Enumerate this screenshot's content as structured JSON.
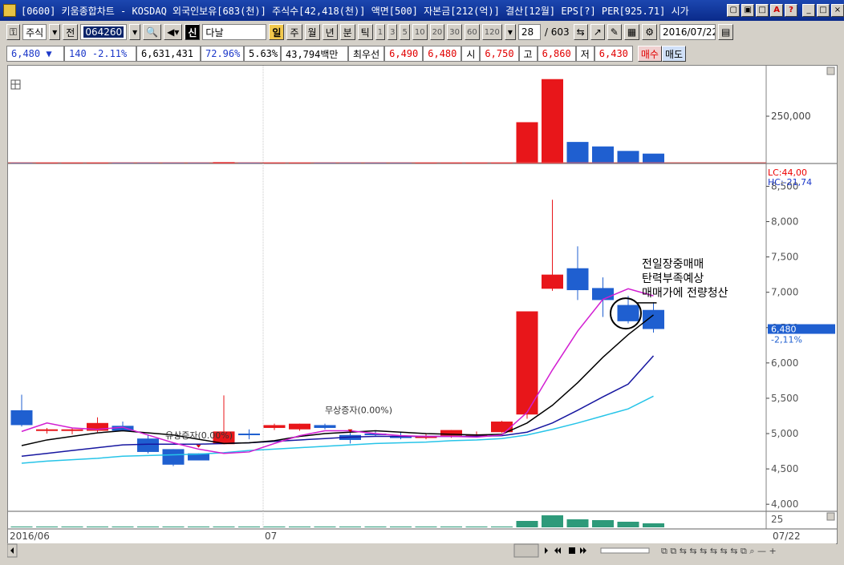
{
  "window": {
    "title": "[0600] 키움종합차트 - KOSDAQ 외국인보유[683(천)] 주식수[42,418(천)] 액면[500] 자본금[212(억)] 결산[12월] EPS[?] PER[925.71] 시가",
    "buttons": [
      "▢",
      "▣",
      "□",
      "A",
      "?",
      "_",
      "□",
      "×"
    ]
  },
  "toolbar": {
    "market": "주식",
    "prev_label": "전",
    "code": "064260",
    "flag": "신",
    "name": "다날",
    "periods": [
      "일",
      "주",
      "월",
      "년",
      "분",
      "틱"
    ],
    "intervals": [
      "1",
      "3",
      "5",
      "10",
      "20",
      "30",
      "60",
      "120"
    ],
    "count": "28",
    "total": "/ 603",
    "date": "2016/07/22"
  },
  "quote": {
    "price": "6,480 ▼",
    "change": "140 -2.11%",
    "volume": "6,631,431",
    "ratio1": "72.96%",
    "ratio2": "5.63%",
    "amount": "43,794백만",
    "best_label": "최우선",
    "ask": "6,490",
    "bid": "6,480",
    "open_label": "시",
    "open": "6,750",
    "high_label": "고",
    "high": "6,860",
    "low_label": "저",
    "low": "6,430",
    "buy_label": "매수",
    "sell_label": "매도"
  },
  "annotations": {
    "rights_issue": "유상증자(0.00%)",
    "bonus_issue": "무상증자(0.00%)",
    "note": [
      "전일장중매매",
      "탄력부족예상",
      "매매가에 전량청산"
    ],
    "lc": "LC:44,00",
    "hc": "HC:-21,74",
    "last_price": "6,480",
    "last_change": "-2,11%",
    "vol_axis": "250,000",
    "sub_axis": "25",
    "date_left": "2016/06",
    "date_mid": "07",
    "date_right": "07/22"
  },
  "colors": {
    "up": "#e8161a",
    "down": "#1f5fd0",
    "ma5": "#d21ed2",
    "ma10": "#000000",
    "ma20": "#1717a0",
    "ma60": "#26c4e8"
  },
  "chart_data": {
    "type": "candlestick",
    "price_ticks": [
      "8,500",
      "8,000",
      "7,500",
      "7,000",
      "6,500",
      "6,000",
      "5,500",
      "5,000",
      "4,500",
      "4,000"
    ],
    "ylim": [
      3900,
      8800
    ],
    "candles": [
      {
        "o": 5330,
        "h": 5550,
        "l": 5100,
        "c": 5120
      },
      {
        "o": 5040,
        "h": 5080,
        "l": 5000,
        "c": 5060
      },
      {
        "o": 5040,
        "h": 5080,
        "l": 4990,
        "c": 5060
      },
      {
        "o": 5040,
        "h": 5230,
        "l": 5020,
        "c": 5150
      },
      {
        "o": 5110,
        "h": 5170,
        "l": 5040,
        "c": 5040
      },
      {
        "o": 4930,
        "h": 4990,
        "l": 4720,
        "c": 4740
      },
      {
        "o": 4780,
        "h": 4780,
        "l": 4540,
        "c": 4560
      },
      {
        "o": 4720,
        "h": 4720,
        "l": 4620,
        "c": 4620
      },
      {
        "o": 4850,
        "h": 5540,
        "l": 4850,
        "c": 5030
      },
      {
        "o": 5000,
        "h": 5060,
        "l": 4920,
        "c": 4980
      },
      {
        "o": 5080,
        "h": 5140,
        "l": 5050,
        "c": 5120
      },
      {
        "o": 5060,
        "h": 5140,
        "l": 5040,
        "c": 5140
      },
      {
        "o": 5120,
        "h": 5140,
        "l": 5060,
        "c": 5080
      },
      {
        "o": 4980,
        "h": 5010,
        "l": 4860,
        "c": 4910
      },
      {
        "o": 5000,
        "h": 5030,
        "l": 4960,
        "c": 4980
      },
      {
        "o": 4960,
        "h": 5020,
        "l": 4920,
        "c": 4940
      },
      {
        "o": 4950,
        "h": 5000,
        "l": 4920,
        "c": 4960
      },
      {
        "o": 4970,
        "h": 5050,
        "l": 4940,
        "c": 5050
      },
      {
        "o": 4980,
        "h": 5030,
        "l": 4960,
        "c": 4990
      },
      {
        "o": 5020,
        "h": 5180,
        "l": 5010,
        "c": 5170
      },
      {
        "o": 5270,
        "h": 6730,
        "l": 5210,
        "c": 6730
      },
      {
        "o": 7050,
        "h": 8310,
        "l": 7020,
        "c": 7250
      },
      {
        "o": 7340,
        "h": 7650,
        "l": 6890,
        "c": 7030
      },
      {
        "o": 7060,
        "h": 7210,
        "l": 6650,
        "c": 6890
      },
      {
        "o": 6820,
        "h": 6950,
        "l": 6560,
        "c": 6590
      },
      {
        "o": 6750,
        "h": 6860,
        "l": 6430,
        "c": 6480
      }
    ],
    "volume": [
      2,
      2,
      2,
      2,
      3,
      2,
      2,
      2,
      8,
      3,
      2,
      2,
      2,
      2,
      2,
      2,
      2,
      2,
      3,
      5,
      230,
      470,
      120,
      95,
      70,
      55
    ],
    "ma5": [
      5030,
      5150,
      5080,
      5060,
      5090,
      4980,
      4870,
      4780,
      4720,
      4740,
      4860,
      4970,
      5040,
      5040,
      5000,
      4970,
      4960,
      4960,
      4950,
      4980,
      5300,
      5900,
      6450,
      6900,
      7050,
      6950
    ],
    "ma10": [
      4830,
      4910,
      4960,
      5010,
      5040,
      5010,
      4980,
      4920,
      4860,
      4870,
      4900,
      4960,
      5000,
      5020,
      5040,
      5020,
      5000,
      4990,
      4980,
      4990,
      5150,
      5400,
      5720,
      6080,
      6400,
      6680
    ],
    "ma20": [
      4680,
      4720,
      4760,
      4800,
      4840,
      4850,
      4850,
      4850,
      4860,
      4870,
      4890,
      4910,
      4930,
      4950,
      4960,
      4960,
      4960,
      4960,
      4960,
      4970,
      5020,
      5150,
      5330,
      5520,
      5700,
      6100
    ],
    "ma60": [
      4580,
      4610,
      4630,
      4650,
      4680,
      4690,
      4700,
      4710,
      4730,
      4760,
      4780,
      4800,
      4820,
      4840,
      4860,
      4870,
      4880,
      4900,
      4910,
      4930,
      4980,
      5060,
      5150,
      5250,
      5350,
      5530
    ],
    "sub_values": [
      1,
      1,
      1,
      1,
      1,
      1,
      1,
      1,
      1,
      1,
      1,
      1,
      1,
      1,
      1,
      1,
      1,
      1,
      1,
      1,
      8,
      15,
      10,
      9,
      7,
      5
    ]
  }
}
